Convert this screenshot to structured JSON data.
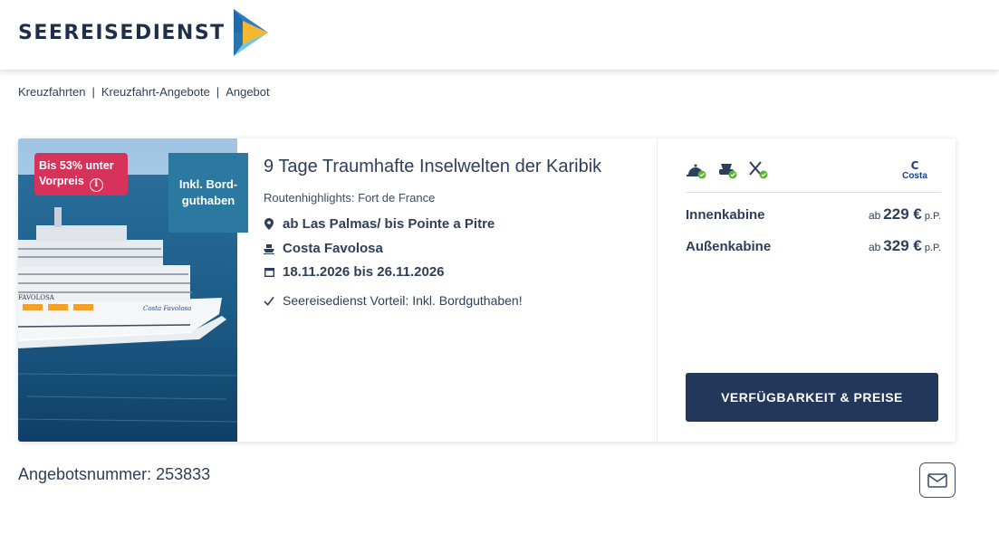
{
  "brand": {
    "name": "SEEREISEDIENST"
  },
  "breadcrumb": [
    {
      "label": "Kreuzfahrten"
    },
    {
      "label": "Kreuzfahrt-Angebote"
    },
    {
      "label": "Angebot"
    }
  ],
  "offer": {
    "discount_badge": "Bis 53% unter Vorpreis",
    "credit_badge": "Inkl. Bord-guthaben",
    "title": "9 Tage Traumhafte Inselwelten der Karibik",
    "highlights": "Routenhighlights: Fort de France",
    "route": "ab Las Palmas/ bis Pointe a Pitre",
    "ship": "Costa Favolosa",
    "dates": "18.11.2026 bis 26.11.2026",
    "vorteil": "Seereisedienst Vorteil: Inkl. Bordguthaben!",
    "ship_name_on_hull": "FAVOLOSA",
    "ship_script_on_hull": "Costa Favolosa"
  },
  "pricing": {
    "operator_logo": "Costa",
    "cabins": [
      {
        "name": "Innenkabine",
        "prefix": "ab",
        "price": "229 €",
        "suffix": "p.P."
      },
      {
        "name": "Außenkabine",
        "prefix": "ab",
        "price": "329 €",
        "suffix": "p.P."
      }
    ],
    "cta_label": "VERFÜGBARKEIT & PREISE"
  },
  "offer_number": "Angebotsnummer: 253833",
  "icons": [
    "logo-arrow-icon",
    "info-icon",
    "location-pin-icon",
    "ship-icon",
    "calendar-icon",
    "check-icon",
    "meals-included-icon",
    "drinks-included-icon",
    "dining-included-icon",
    "mail-icon"
  ],
  "colors": {
    "primary": "#22375a",
    "discount": "#d9325a",
    "credit": "#2b79a0",
    "check": "#5bb531"
  }
}
